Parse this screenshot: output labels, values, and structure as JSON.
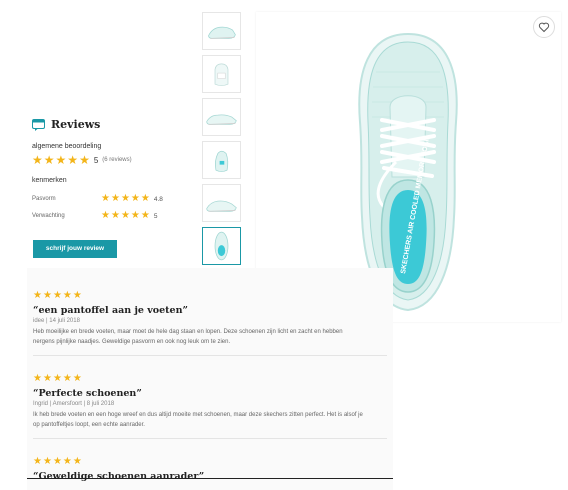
{
  "reviews_panel": {
    "title": "Reviews",
    "overall_label": "algemene beoordeling",
    "overall_score": "5",
    "review_count": "(6 reviews)",
    "features_label": "kenmerken",
    "features": [
      {
        "label": "Pasvorm",
        "score": "4.8"
      },
      {
        "label": "Verwachting",
        "score": "5"
      }
    ],
    "write_review_label": "schrijf jouw review"
  },
  "reviews": [
    {
      "title": "“een pantoffel aan je voeten”",
      "meta": "idee | 14 juli 2018",
      "body_lines": [
        "Heb moeilijke en brede voeten, maar moet de hele dag staan en lopen. Deze schoenen zijn licht en zacht en hebben",
        "nergens pijnlijke naadjes. Geweldige pasvorm en ook nog leuk om te zien."
      ]
    },
    {
      "title": "“Perfecte schoenen”",
      "meta": "Ingrid | Amersfoort | 8 juli 2018",
      "body_lines": [
        "Ik heb brede voeten en een hoge wreef en dus altijd moeite met schoenen, maar deze skechers zitten perfect. Het is alsof je",
        "op pantoffeltjes loopt, een echte aanrader."
      ]
    },
    {
      "title": "“Geweldige schoenen aanrader”",
      "meta": "",
      "body_lines": []
    }
  ],
  "insole_print": "SKECHERS AIR COOLED MEMORY FOAM",
  "colors": {
    "accent": "#1a98a6",
    "star": "#f3b51a",
    "shoe": "#d7efec",
    "insole": "#3cc9d6"
  }
}
